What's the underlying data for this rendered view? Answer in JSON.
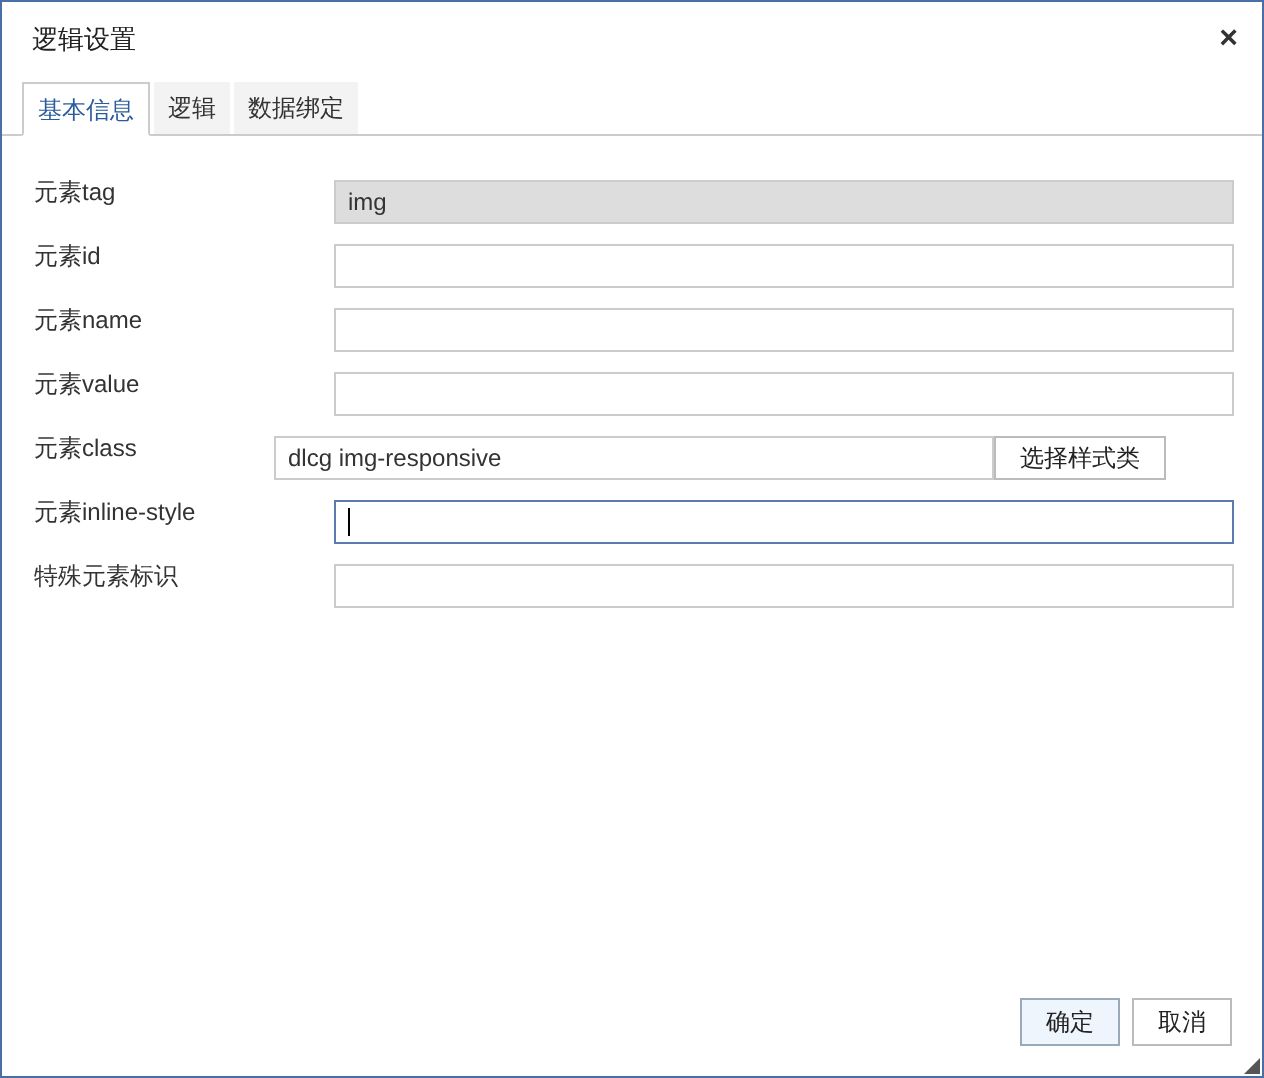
{
  "window": {
    "title": "逻辑设置",
    "close": "×"
  },
  "tabs": [
    {
      "label": "基本信息",
      "selected": true
    },
    {
      "label": "逻辑",
      "selected": false
    },
    {
      "label": "数据绑定",
      "selected": false
    }
  ],
  "fields": [
    {
      "label": "元素tag",
      "kind": "readonly",
      "value": "img",
      "focused": false
    },
    {
      "label": "元素id",
      "kind": "text",
      "focused": false
    },
    {
      "label": "元素name",
      "kind": "text",
      "focused": false
    },
    {
      "label": "元素value",
      "kind": "text",
      "focused": false
    },
    {
      "label": "元素class",
      "kind": "with_button",
      "value": "dlcg img-responsive",
      "button": "选择样式类",
      "focused": false
    },
    {
      "label": "元素inline-style",
      "kind": "text",
      "focused": true
    },
    {
      "label": "特殊元素标识",
      "kind": "text",
      "focused": false
    }
  ],
  "buttons": [
    {
      "label": "确定",
      "kind": "primary"
    },
    {
      "label": "取消",
      "kind": "default"
    }
  ]
}
